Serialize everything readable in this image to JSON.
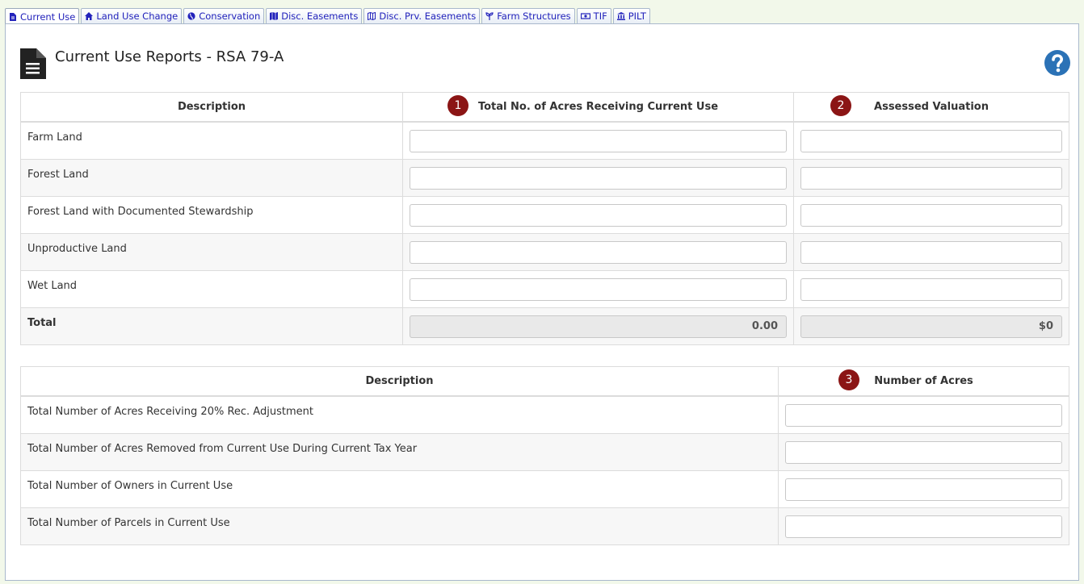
{
  "tabs": [
    {
      "label": "Current Use",
      "icon": "document-icon",
      "active": true
    },
    {
      "label": "Land Use Change",
      "icon": "home-icon",
      "active": false
    },
    {
      "label": "Conservation",
      "icon": "globe-icon",
      "active": false
    },
    {
      "label": "Disc. Easements",
      "icon": "map-icon",
      "active": false
    },
    {
      "label": "Disc. Prv. Easements",
      "icon": "map-outline-icon",
      "active": false
    },
    {
      "label": "Farm Structures",
      "icon": "seedling-icon",
      "active": false
    },
    {
      "label": "TIF",
      "icon": "money-icon",
      "active": false
    },
    {
      "label": "PILT",
      "icon": "bank-icon",
      "active": false
    }
  ],
  "page": {
    "title": "Current Use Reports - RSA 79-A",
    "icon": "document-icon",
    "help_icon": "question-circle-icon",
    "help_color": "#2b72b6"
  },
  "table1": {
    "headers": {
      "description": "Description",
      "acres": "Total No. of Acres Receiving Current Use",
      "valuation": "Assessed Valuation"
    },
    "badges": {
      "acres": "1",
      "valuation": "2"
    },
    "rows": [
      {
        "label": "Farm Land"
      },
      {
        "label": "Forest Land"
      },
      {
        "label": "Forest Land with Documented Stewardship"
      },
      {
        "label": "Unproductive Land"
      },
      {
        "label": "Wet Land"
      }
    ],
    "total": {
      "label": "Total",
      "acres": "0.00",
      "valuation": "$0"
    }
  },
  "table2": {
    "headers": {
      "description": "Description",
      "acres": "Number of Acres"
    },
    "badges": {
      "acres": "3"
    },
    "rows": [
      {
        "label": "Total Number of Acres Receiving 20% Rec. Adjustment"
      },
      {
        "label": "Total Number of Acres Removed from Current Use During Current Tax Year"
      },
      {
        "label": "Total Number of Owners in Current Use"
      },
      {
        "label": "Total Number of Parcels in Current Use"
      }
    ]
  },
  "colors": {
    "badge": "#8b1515",
    "tab_text": "#2222bb",
    "page_background": "#f2f8ea"
  }
}
